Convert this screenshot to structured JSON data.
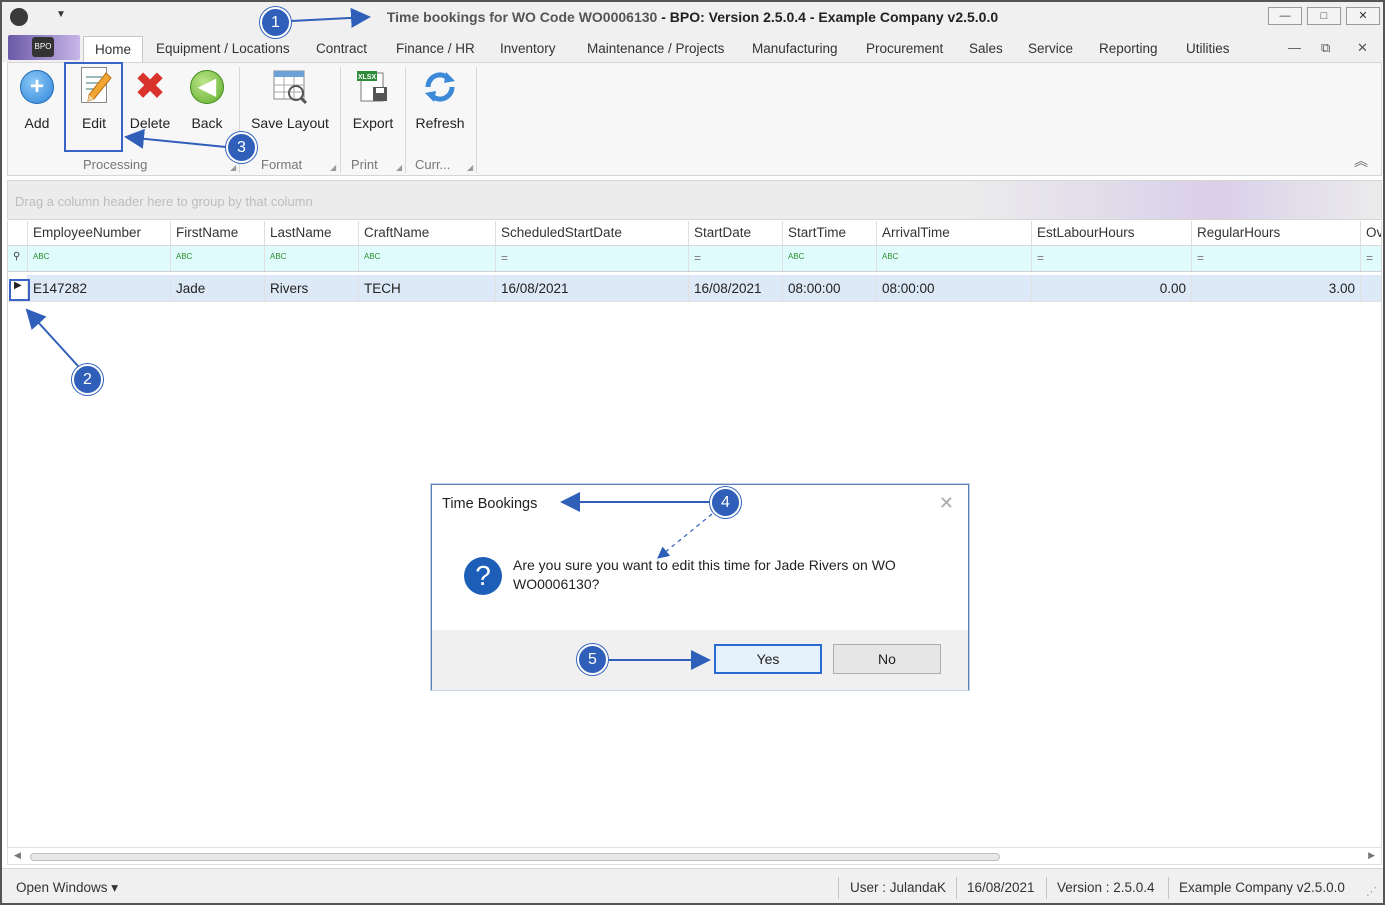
{
  "window": {
    "title_main": "Time bookings for WO Code WO0006130",
    "title_sep": " - ",
    "title_app": "BPO: Version 2.5.0.4 - Example Company v2.5.0.0",
    "logo_text": "BPO",
    "controls": {
      "minimize": "—",
      "maximize": "□",
      "close": "✕"
    }
  },
  "menu": {
    "tabs": [
      "Home",
      "Equipment / Locations",
      "Contract",
      "Finance / HR",
      "Inventory",
      "Maintenance / Projects",
      "Manufacturing",
      "Procurement",
      "Sales",
      "Service",
      "Reporting",
      "Utilities"
    ],
    "mdi_controls": {
      "minimize": "—",
      "restore": "⧉",
      "close": "✕"
    }
  },
  "ribbon": {
    "buttons": {
      "add": "Add",
      "edit": "Edit",
      "delete": "Delete",
      "back": "Back",
      "save_layout": "Save Layout",
      "export": "Export",
      "refresh": "Refresh"
    },
    "groups": {
      "processing": "Processing",
      "format": "Format",
      "print": "Print",
      "current": "Curr..."
    },
    "export_badge": "XLSX",
    "collapse_icon": "︽"
  },
  "grid": {
    "group_panel_hint": "Drag a column header here to group by that column",
    "columns": [
      "EmployeeNumber",
      "FirstName",
      "LastName",
      "CraftName",
      "ScheduledStartDate",
      "StartDate",
      "StartTime",
      "ArrivalTime",
      "EstLabourHours",
      "RegularHours",
      "Ov"
    ],
    "filter_symbols": {
      "text": "ABC",
      "equal": "="
    },
    "rows": [
      {
        "EmployeeNumber": "E147282",
        "FirstName": "Jade",
        "LastName": "Rivers",
        "CraftName": "TECH",
        "ScheduledStartDate": "16/08/2021",
        "StartDate": "16/08/2021",
        "StartTime": "08:00:00",
        "ArrivalTime": "08:00:00",
        "EstLabourHours": "0.00",
        "RegularHours": "3.00",
        "Ov": ""
      }
    ]
  },
  "statusbar": {
    "open_windows": "Open Windows ▾",
    "user": "User : JulandaK",
    "date": "16/08/2021",
    "version": "Version : 2.5.0.4",
    "company": "Example Company v2.5.0.0"
  },
  "dialog": {
    "title": "Time Bookings",
    "message": "Are you sure you want to edit this time for Jade Rivers on WO WO0006130?",
    "question_glyph": "?",
    "yes": "Yes",
    "no": "No",
    "close_glyph": "✕"
  },
  "annotations": {
    "badges": [
      "1",
      "2",
      "3",
      "4",
      "5"
    ],
    "color": "#2f5fb8"
  }
}
